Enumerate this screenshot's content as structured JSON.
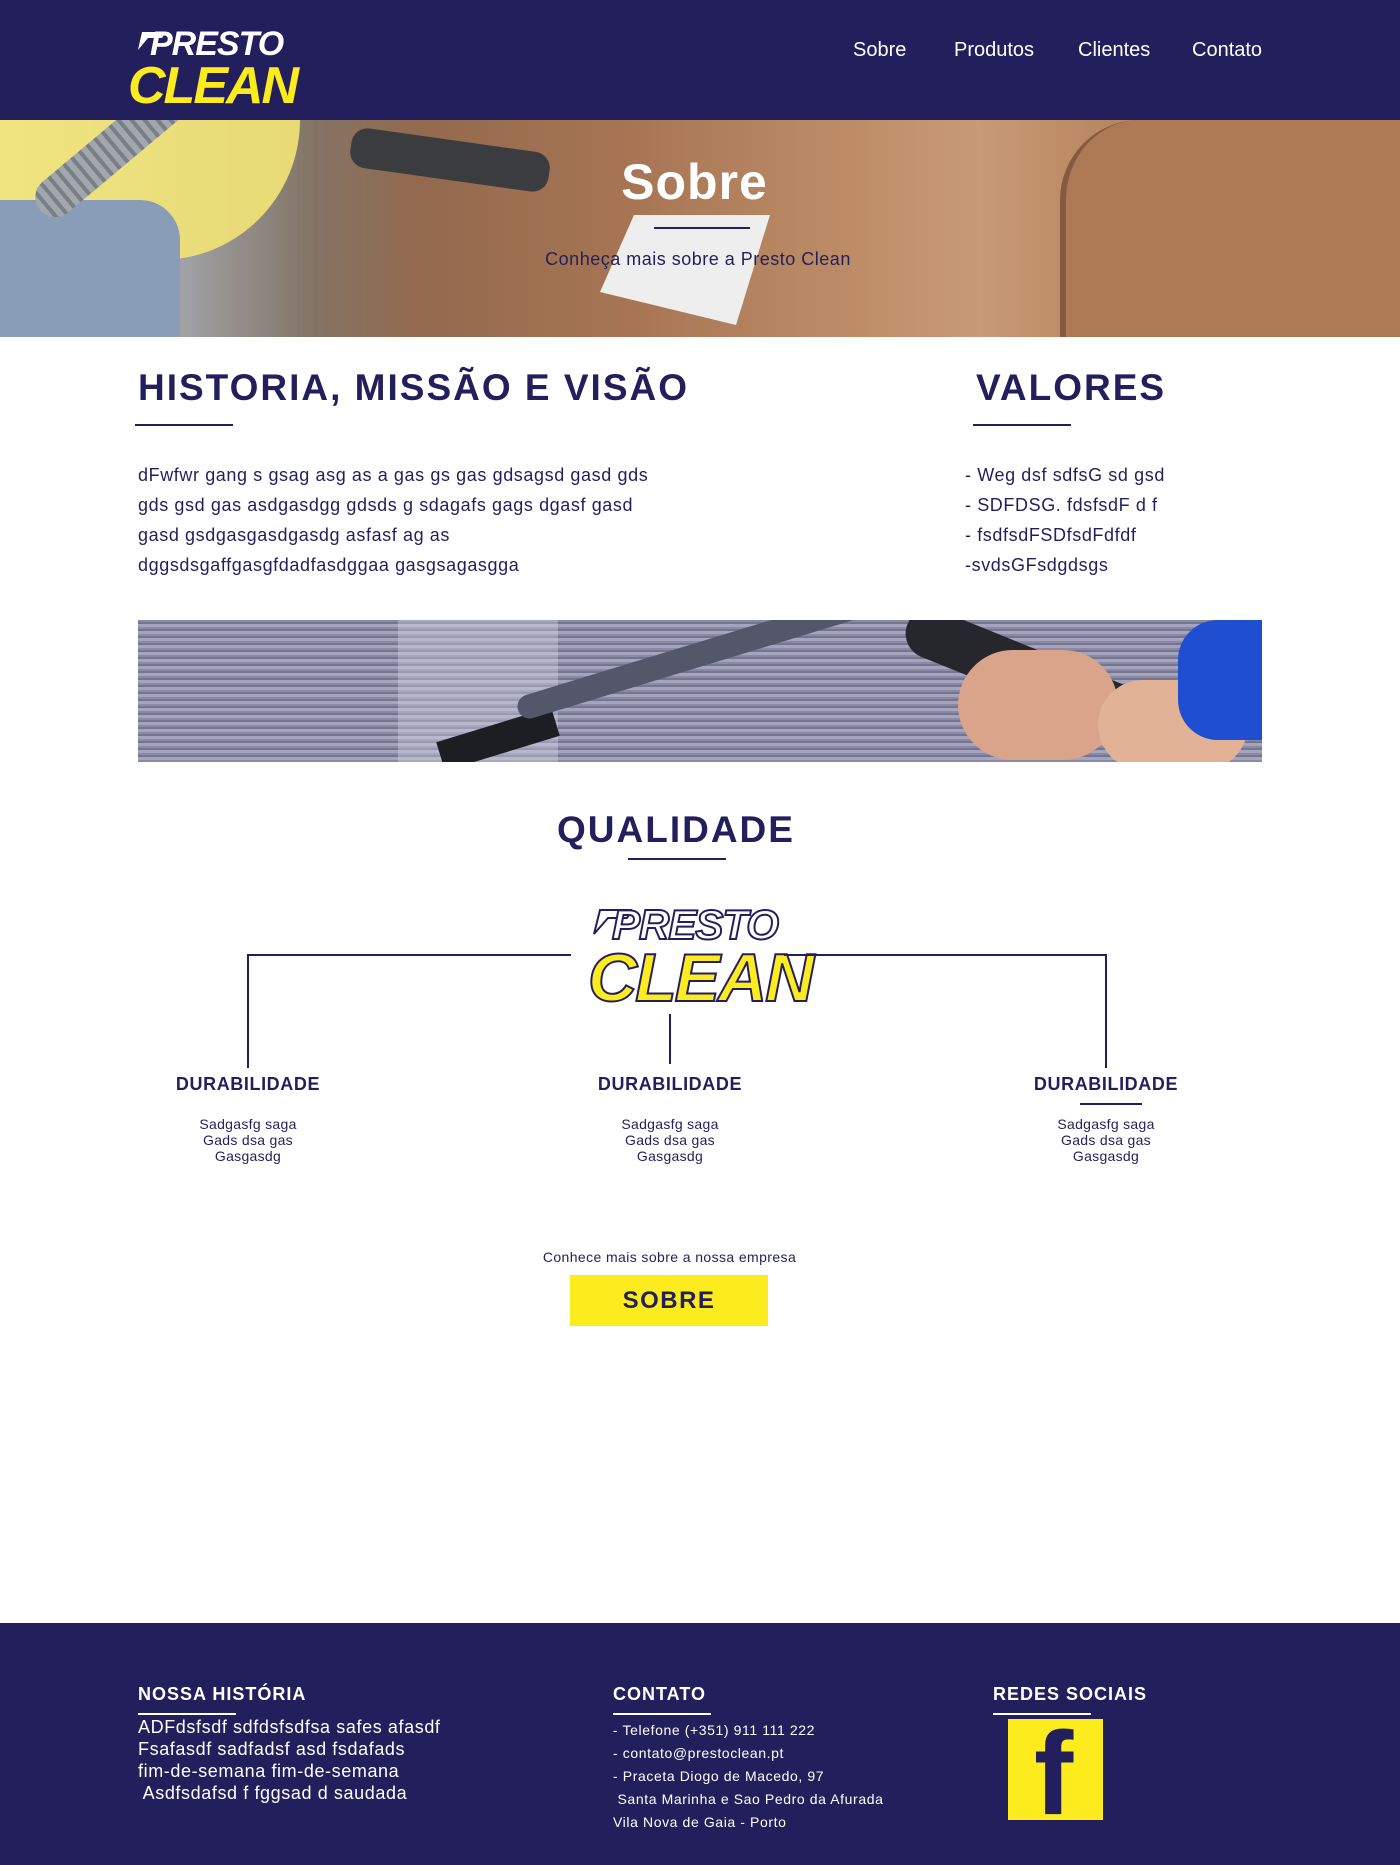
{
  "brand": {
    "logo_top": "PRESTO",
    "logo_bottom": "CLEAN",
    "colors": {
      "navy": "#231f5c",
      "yellow": "#fcec1d",
      "white": "#ffffff"
    }
  },
  "nav": {
    "items": [
      {
        "label": "Sobre"
      },
      {
        "label": "Produtos"
      },
      {
        "label": "Clientes"
      },
      {
        "label": "Contato"
      }
    ]
  },
  "hero": {
    "title": "Sobre",
    "subtitle": "Conheça mais sobre a Presto Clean"
  },
  "historia": {
    "title": "HISTORIA, MISSÃO E VISÃO",
    "lines": [
      "dFwfwr  gang s gsag asg as a gas gs gas gdsagsd gasd gds",
      "gds gsd gas asdgasdgg gdsds g sdagafs gags dgasf gasd",
      "gasd gsdgasgasdgasdg asfasf ag as",
      "dggsdsgaffgasgfdadfasdggaa gasgsagasgga"
    ]
  },
  "valores": {
    "title": "VALORES",
    "items": [
      "- Weg  dsf sdfsG sd gsd",
      "- SDFDSG. fdsfsdF d f",
      "- fsdfsdFSDfsdFdfdf",
      "-svdsGFsdgdsgs"
    ]
  },
  "qualidade": {
    "title": "QUALIDADE",
    "items": [
      {
        "title": "DURABILIDADE",
        "lines": [
          "Sadgasfg saga",
          "Gads dsa gas",
          "Gasgasdg"
        ]
      },
      {
        "title": "DURABILIDADE",
        "lines": [
          "Sadgasfg saga",
          "Gads dsa gas",
          "Gasgasdg"
        ]
      },
      {
        "title": "DURABILIDADE",
        "lines": [
          "Sadgasfg saga",
          "Gads dsa gas",
          "Gasgasdg"
        ]
      }
    ]
  },
  "cta": {
    "text": "Conhece mais sobre a nossa empresa",
    "button_label": "SOBRE"
  },
  "footer": {
    "historia": {
      "title": "NOSSA HISTÓRIA",
      "lines": [
        "ADFdsfsdf sdfdsfsdfsa safes afasdf",
        "Fsafasdf sadfadsf asd fsdafads",
        "fim-de-semana fim-de-semana",
        " Asdfsdafsd f fggsad d saudada"
      ]
    },
    "contato": {
      "title": "CONTATO",
      "lines": [
        "- Telefone (+351) 911 111 222",
        "- contato@prestoclean.pt",
        "- Praceta Diogo de Macedo, 97",
        " Santa Marinha e Sao Pedro da Afurada",
        "Vila Nova de Gaia - Porto"
      ]
    },
    "redes": {
      "title": "REDES SOCIAIS",
      "facebook_glyph": "f",
      "icon": "facebook-icon"
    }
  }
}
